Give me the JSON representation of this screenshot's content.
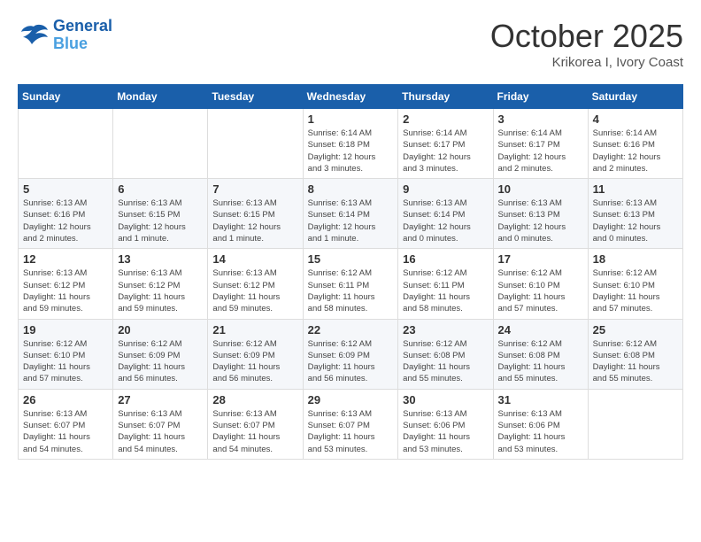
{
  "header": {
    "logo_line1": "General",
    "logo_line2": "Blue",
    "month": "October 2025",
    "location": "Krikorea I, Ivory Coast"
  },
  "weekdays": [
    "Sunday",
    "Monday",
    "Tuesday",
    "Wednesday",
    "Thursday",
    "Friday",
    "Saturday"
  ],
  "weeks": [
    [
      {
        "day": "",
        "info": ""
      },
      {
        "day": "",
        "info": ""
      },
      {
        "day": "",
        "info": ""
      },
      {
        "day": "1",
        "info": "Sunrise: 6:14 AM\nSunset: 6:18 PM\nDaylight: 12 hours\nand 3 minutes."
      },
      {
        "day": "2",
        "info": "Sunrise: 6:14 AM\nSunset: 6:17 PM\nDaylight: 12 hours\nand 3 minutes."
      },
      {
        "day": "3",
        "info": "Sunrise: 6:14 AM\nSunset: 6:17 PM\nDaylight: 12 hours\nand 2 minutes."
      },
      {
        "day": "4",
        "info": "Sunrise: 6:14 AM\nSunset: 6:16 PM\nDaylight: 12 hours\nand 2 minutes."
      }
    ],
    [
      {
        "day": "5",
        "info": "Sunrise: 6:13 AM\nSunset: 6:16 PM\nDaylight: 12 hours\nand 2 minutes."
      },
      {
        "day": "6",
        "info": "Sunrise: 6:13 AM\nSunset: 6:15 PM\nDaylight: 12 hours\nand 1 minute."
      },
      {
        "day": "7",
        "info": "Sunrise: 6:13 AM\nSunset: 6:15 PM\nDaylight: 12 hours\nand 1 minute."
      },
      {
        "day": "8",
        "info": "Sunrise: 6:13 AM\nSunset: 6:14 PM\nDaylight: 12 hours\nand 1 minute."
      },
      {
        "day": "9",
        "info": "Sunrise: 6:13 AM\nSunset: 6:14 PM\nDaylight: 12 hours\nand 0 minutes."
      },
      {
        "day": "10",
        "info": "Sunrise: 6:13 AM\nSunset: 6:13 PM\nDaylight: 12 hours\nand 0 minutes."
      },
      {
        "day": "11",
        "info": "Sunrise: 6:13 AM\nSunset: 6:13 PM\nDaylight: 12 hours\nand 0 minutes."
      }
    ],
    [
      {
        "day": "12",
        "info": "Sunrise: 6:13 AM\nSunset: 6:12 PM\nDaylight: 11 hours\nand 59 minutes."
      },
      {
        "day": "13",
        "info": "Sunrise: 6:13 AM\nSunset: 6:12 PM\nDaylight: 11 hours\nand 59 minutes."
      },
      {
        "day": "14",
        "info": "Sunrise: 6:13 AM\nSunset: 6:12 PM\nDaylight: 11 hours\nand 59 minutes."
      },
      {
        "day": "15",
        "info": "Sunrise: 6:12 AM\nSunset: 6:11 PM\nDaylight: 11 hours\nand 58 minutes."
      },
      {
        "day": "16",
        "info": "Sunrise: 6:12 AM\nSunset: 6:11 PM\nDaylight: 11 hours\nand 58 minutes."
      },
      {
        "day": "17",
        "info": "Sunrise: 6:12 AM\nSunset: 6:10 PM\nDaylight: 11 hours\nand 57 minutes."
      },
      {
        "day": "18",
        "info": "Sunrise: 6:12 AM\nSunset: 6:10 PM\nDaylight: 11 hours\nand 57 minutes."
      }
    ],
    [
      {
        "day": "19",
        "info": "Sunrise: 6:12 AM\nSunset: 6:10 PM\nDaylight: 11 hours\nand 57 minutes."
      },
      {
        "day": "20",
        "info": "Sunrise: 6:12 AM\nSunset: 6:09 PM\nDaylight: 11 hours\nand 56 minutes."
      },
      {
        "day": "21",
        "info": "Sunrise: 6:12 AM\nSunset: 6:09 PM\nDaylight: 11 hours\nand 56 minutes."
      },
      {
        "day": "22",
        "info": "Sunrise: 6:12 AM\nSunset: 6:09 PM\nDaylight: 11 hours\nand 56 minutes."
      },
      {
        "day": "23",
        "info": "Sunrise: 6:12 AM\nSunset: 6:08 PM\nDaylight: 11 hours\nand 55 minutes."
      },
      {
        "day": "24",
        "info": "Sunrise: 6:12 AM\nSunset: 6:08 PM\nDaylight: 11 hours\nand 55 minutes."
      },
      {
        "day": "25",
        "info": "Sunrise: 6:12 AM\nSunset: 6:08 PM\nDaylight: 11 hours\nand 55 minutes."
      }
    ],
    [
      {
        "day": "26",
        "info": "Sunrise: 6:13 AM\nSunset: 6:07 PM\nDaylight: 11 hours\nand 54 minutes."
      },
      {
        "day": "27",
        "info": "Sunrise: 6:13 AM\nSunset: 6:07 PM\nDaylight: 11 hours\nand 54 minutes."
      },
      {
        "day": "28",
        "info": "Sunrise: 6:13 AM\nSunset: 6:07 PM\nDaylight: 11 hours\nand 54 minutes."
      },
      {
        "day": "29",
        "info": "Sunrise: 6:13 AM\nSunset: 6:07 PM\nDaylight: 11 hours\nand 53 minutes."
      },
      {
        "day": "30",
        "info": "Sunrise: 6:13 AM\nSunset: 6:06 PM\nDaylight: 11 hours\nand 53 minutes."
      },
      {
        "day": "31",
        "info": "Sunrise: 6:13 AM\nSunset: 6:06 PM\nDaylight: 11 hours\nand 53 minutes."
      },
      {
        "day": "",
        "info": ""
      }
    ]
  ]
}
